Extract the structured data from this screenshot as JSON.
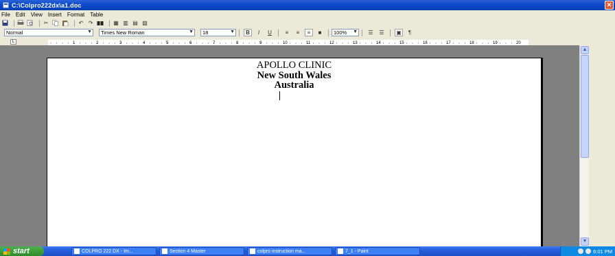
{
  "window": {
    "title": "C:\\Colpro222dx\\a1.doc",
    "close_label": "✕"
  },
  "menu": [
    "File",
    "Edit",
    "View",
    "Insert",
    "Format",
    "Table"
  ],
  "toolbar": {
    "icons": [
      "save-icon",
      "print-icon",
      "print-preview-icon",
      "cut-icon",
      "copy-icon",
      "paste-icon",
      "undo-icon",
      "redo-icon",
      "find-icon",
      "table-icon",
      "columns-icon",
      "insert-table-icon",
      "spelling-icon"
    ]
  },
  "format_bar": {
    "style": "Normal",
    "font": "Times New Roman",
    "size": "18",
    "bold": "B",
    "italic": "I",
    "underline": "U",
    "zoom": "100%",
    "pilcrow": "¶"
  },
  "ruler": {
    "tab_marker": "L",
    "numbers": [
      "1",
      "2",
      "3",
      "4",
      "5",
      "6",
      "7",
      "8",
      "9",
      "10",
      "11",
      "12",
      "13",
      "14",
      "15",
      "16",
      "17",
      "18",
      "19",
      "20"
    ]
  },
  "document": {
    "lines": [
      "APOLLO CLINIC",
      "New South Wales",
      "Australia"
    ]
  },
  "taskbar": {
    "start_label": "start",
    "tasks": [
      "COLPRO 222 DX - Im...",
      "Section 4 Master",
      "colpro instruction ma...",
      "7_1 - Paint"
    ],
    "clock": "6:01 PM"
  },
  "colors": {
    "title_bar": "#0a46c8",
    "chrome": "#ece9d8",
    "taskbar": "#245edb",
    "start_button": "#379b37"
  }
}
